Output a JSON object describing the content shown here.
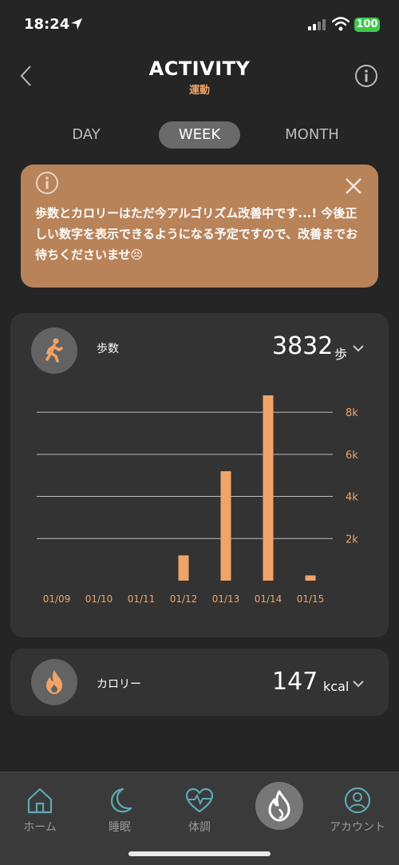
{
  "status": {
    "time": "18:24",
    "battery": "100"
  },
  "header": {
    "title": "ACTIVITY",
    "subtitle": "運動"
  },
  "tabs": [
    {
      "label": "DAY"
    },
    {
      "label": "WEEK"
    },
    {
      "label": "MONTH"
    }
  ],
  "selected_tab": "WEEK",
  "notice": {
    "text": "歩数とカロリーはただ今アルゴリズム改善中です...! 今後正しい数字を表示できるようになる予定ですので、改善までお待ちくださいませ😣"
  },
  "steps": {
    "label": "歩数",
    "value": "3832",
    "unit": "歩"
  },
  "calories": {
    "label": "カロリー",
    "value": "147",
    "unit": "kcal"
  },
  "nav": {
    "home": "ホーム",
    "sleep": "睡眠",
    "health": "体調",
    "account": "アカウント"
  },
  "colors": {
    "accent": "#f0a468",
    "notice_bg": "#b9835a",
    "card_bg": "#333333",
    "bg": "#252525"
  },
  "chart_data": {
    "type": "bar",
    "categories": [
      "01/09",
      "01/10",
      "01/11",
      "01/12",
      "01/13",
      "01/14",
      "01/15"
    ],
    "values": [
      0,
      0,
      0,
      1200,
      5200,
      8800,
      250
    ],
    "y_ticks": [
      "2k",
      "4k",
      "6k",
      "8k"
    ],
    "ylim": [
      0,
      8800
    ],
    "grid": true,
    "color": "#f0a468"
  }
}
